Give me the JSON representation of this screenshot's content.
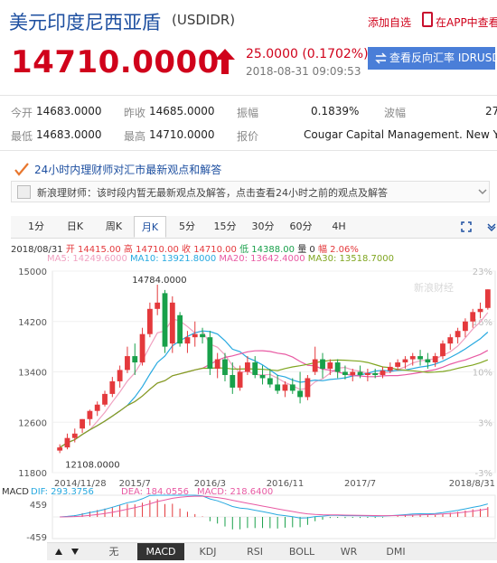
{
  "header": {
    "title": "美元印度尼西亚盾",
    "code": "(USDIDR)",
    "add_watch": "添加自选",
    "open_app": "在APP中查看",
    "price": "14710.0000",
    "change": "25.0000 (0.1702%)",
    "timestamp": "2018-08-31 09:09:53",
    "reverse_button": "查看反向汇率 IDRUSD"
  },
  "stats": {
    "open_label": "今开",
    "open": "14683.0000",
    "prev_label": "昨收",
    "prev": "14685.0000",
    "amp_label": "振幅",
    "amp": "0.1839%",
    "wave_label": "波幅",
    "wave": "27",
    "low_label": "最低",
    "low": "14683.0000",
    "high_label": "最高",
    "high": "14710.0000",
    "quote_label": "报价",
    "quote": "Cougar Capital Management. New York"
  },
  "expert": {
    "link": "24小时内理财师对汇市最新观点和解答",
    "comment": "新浪理财师：该时段内暂无最新观点及解答，点击查看24小时之前的观点及解答"
  },
  "tabs": [
    "1分",
    "日K",
    "周K",
    "月K",
    "5分",
    "15分",
    "30分",
    "60分",
    "4H"
  ],
  "active_tab": "月K",
  "ohlc": {
    "date": "2018/08/31",
    "open": "开 14415.00",
    "high": "高 14710.00",
    "close": "收 14710.00",
    "low": "低 14388.00",
    "vol": "量 0",
    "pct": "幅 2.06%"
  },
  "ma": {
    "ma5": "MA5: 14249.6000",
    "ma10": "MA10: 13921.8000",
    "ma20": "MA20: 13642.4000",
    "ma30": "MA30: 13518.7000"
  },
  "chart_labels": {
    "watermark": "新浪财经",
    "max_label": "14784.0000",
    "min_label": "12108.0000",
    "yticks": [
      "15000",
      "14200",
      "13400",
      "12600",
      "11800"
    ],
    "rticks": [
      "23%",
      "16%",
      "10%",
      "3%",
      "-3%"
    ],
    "xticks": [
      "2014/11/28",
      "2015/7",
      "2016/3",
      "2016/11",
      "2017/7",
      "2018/8/31"
    ]
  },
  "macd": {
    "label": "MACD",
    "dif": "DIF: 293.3756",
    "dea": "DEA: 184.0556",
    "macd": "MACD: 218.6400",
    "top": "459",
    "bottom": "-459"
  },
  "bottom_buttons": [
    "无",
    "MACD",
    "KDJ",
    "RSI",
    "BOLL",
    "WR",
    "DMI"
  ],
  "active_bottom": "MACD",
  "colors": {
    "up": "#e4393c",
    "down": "#18a04a",
    "accent": "#1d4fa0",
    "ma5": "#f0a0c0",
    "ma10": "#27a9e0",
    "ma20": "#e85aa3",
    "ma30": "#7fa51f"
  },
  "chart_data": {
    "type": "candlestick",
    "ylim": [
      11800,
      15000
    ],
    "candles": [
      [
        12150,
        12250,
        12110,
        12200
      ],
      [
        12200,
        12420,
        12170,
        12350
      ],
      [
        12350,
        12500,
        12280,
        12420
      ],
      [
        12500,
        12650,
        12430,
        12650
      ],
      [
        12650,
        12800,
        12550,
        12780
      ],
      [
        12780,
        12930,
        12700,
        12880
      ],
      [
        12880,
        13100,
        12850,
        13050
      ],
      [
        13050,
        13320,
        13000,
        13250
      ],
      [
        13250,
        13500,
        13150,
        13430
      ],
      [
        13430,
        13800,
        13380,
        13650
      ],
      [
        13650,
        13850,
        13350,
        13550
      ],
      [
        13550,
        14100,
        13500,
        14000
      ],
      [
        14000,
        14500,
        13950,
        14400
      ],
      [
        14400,
        14784,
        14300,
        14500
      ],
      [
        14650,
        14700,
        13700,
        13800
      ],
      [
        13850,
        14600,
        13700,
        14500
      ],
      [
        14300,
        14350,
        13800,
        13850
      ],
      [
        13850,
        14050,
        13700,
        13950
      ],
      [
        13950,
        14200,
        13800,
        14000
      ],
      [
        14000,
        14100,
        13850,
        13950
      ],
      [
        13950,
        14050,
        13350,
        13450
      ],
      [
        13450,
        13700,
        13300,
        13600
      ],
      [
        13600,
        13700,
        13250,
        13350
      ],
      [
        13350,
        13550,
        13050,
        13150
      ],
      [
        13150,
        13500,
        13100,
        13400
      ],
      [
        13400,
        13650,
        13350,
        13550
      ],
      [
        13550,
        13650,
        13300,
        13350
      ],
      [
        13350,
        13500,
        13200,
        13300
      ],
      [
        13300,
        13450,
        13150,
        13200
      ],
      [
        13200,
        13350,
        13050,
        13100
      ],
      [
        13100,
        13250,
        13000,
        13200
      ],
      [
        13200,
        13300,
        13050,
        13100
      ],
      [
        13100,
        13400,
        12900,
        13000
      ],
      [
        13000,
        13350,
        12950,
        13300
      ],
      [
        13400,
        13800,
        13350,
        13600
      ],
      [
        13600,
        13700,
        13300,
        13450
      ],
      [
        13450,
        13600,
        13350,
        13550
      ],
      [
        13550,
        13600,
        13300,
        13400
      ],
      [
        13400,
        13500,
        13280,
        13350
      ],
      [
        13350,
        13450,
        13250,
        13400
      ],
      [
        13400,
        13500,
        13300,
        13350
      ],
      [
        13350,
        13450,
        13250,
        13380
      ],
      [
        13380,
        13450,
        13300,
        13350
      ],
      [
        13350,
        13480,
        13300,
        13420
      ],
      [
        13420,
        13550,
        13380,
        13480
      ],
      [
        13480,
        13600,
        13420,
        13550
      ],
      [
        13550,
        13650,
        13450,
        13600
      ],
      [
        13600,
        13700,
        13500,
        13650
      ],
      [
        13650,
        13750,
        13500,
        13600
      ],
      [
        13600,
        13700,
        13450,
        13550
      ],
      [
        13550,
        13700,
        13480,
        13650
      ],
      [
        13650,
        13900,
        13600,
        13850
      ],
      [
        13850,
        14000,
        13750,
        13950
      ],
      [
        13950,
        14100,
        13850,
        14050
      ],
      [
        14050,
        14250,
        13950,
        14200
      ],
      [
        14200,
        14400,
        14100,
        14350
      ],
      [
        14350,
        14500,
        14250,
        14400
      ],
      [
        14415,
        14710,
        14388,
        14710
      ]
    ]
  }
}
